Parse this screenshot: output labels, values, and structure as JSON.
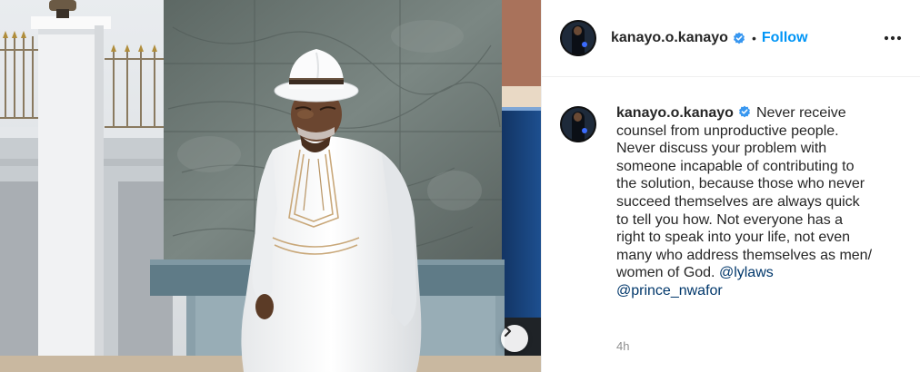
{
  "post": {
    "username": "kanayo.o.kanayo",
    "follow_label": "Follow",
    "separator": "•",
    "caption_lines": [
      "Never receive",
      "counsel from unproductive people.",
      "Never discuss your problem with",
      "someone incapable of contributing to",
      "the solution, because those who never",
      "succeed themselves are always quick",
      "to tell you how. Not everyone has a",
      "right to speak into your life, not even",
      "many who address themselves as men/",
      "women of God."
    ],
    "mentions": [
      "@lylaws",
      "@prince_nwafor"
    ],
    "timestamp": "4h"
  },
  "colors": {
    "accent": "#0095f6",
    "mention": "#00376b",
    "verified": "#3897f0",
    "muted": "#8e8e8e"
  },
  "icons": {
    "verified": "verified-badge-icon",
    "more": "more-options-icon",
    "next": "chevron-right-icon"
  }
}
